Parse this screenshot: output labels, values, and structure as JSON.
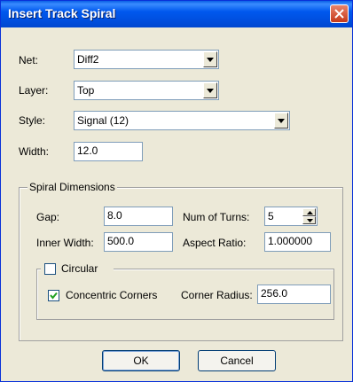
{
  "window": {
    "title": "Insert Track Spiral"
  },
  "net": {
    "label": "Net:",
    "value": "Diff2"
  },
  "layer": {
    "label": "Layer:",
    "value": "Top"
  },
  "style": {
    "label": "Style:",
    "value": "Signal (12)"
  },
  "width": {
    "label": "Width:",
    "value": "12.0"
  },
  "spiral": {
    "group_label": "Spiral Dimensions",
    "gap": {
      "label": "Gap:",
      "value": "8.0"
    },
    "turns": {
      "label": "Num of Turns:",
      "value": "5"
    },
    "inner_width": {
      "label": "Inner Width:",
      "value": "500.0"
    },
    "aspect_ratio": {
      "label": "Aspect Ratio:",
      "value": "1.000000"
    },
    "circular": {
      "label": "Circular",
      "checked": false
    },
    "concentric": {
      "label": "Concentric Corners",
      "checked": true
    },
    "corner_radius": {
      "label": "Corner Radius:",
      "value": "256.0"
    }
  },
  "buttons": {
    "ok": "OK",
    "cancel": "Cancel"
  }
}
